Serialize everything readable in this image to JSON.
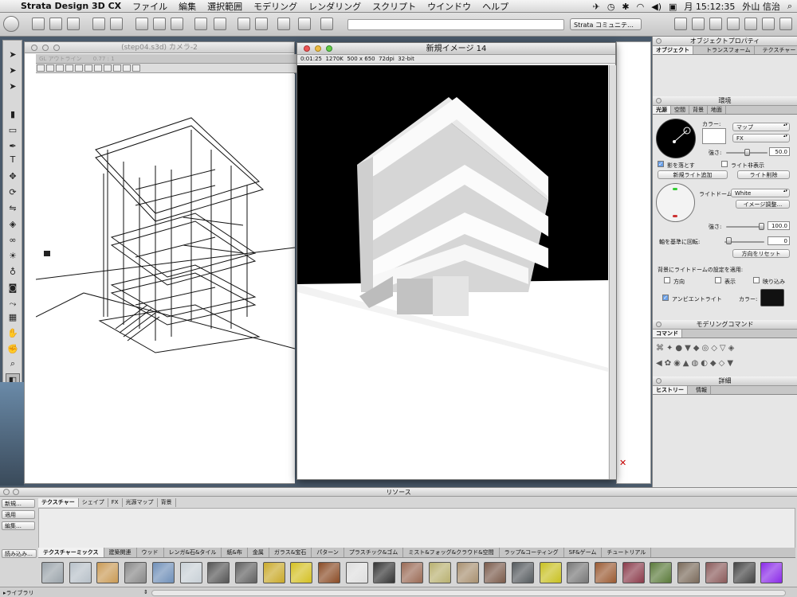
{
  "menubar": {
    "app_name": "Strata Design 3D CX",
    "items": [
      "ファイル",
      "編集",
      "選択範囲",
      "モデリング",
      "レンダリング",
      "スクリプト",
      "ウインドウ",
      "ヘルプ"
    ],
    "clock": "月 15:12:35",
    "user": "外山 信治"
  },
  "toolbar": {
    "community_select": "Strata コミュニテ…"
  },
  "camera_window": {
    "title": "(step04.s3d) カメラ-2",
    "mode": "GL アウトライン",
    "zoom": "0.77 : 1"
  },
  "render_window": {
    "title": "新規イメージ 14",
    "time": "0:01:25",
    "size": "1270K",
    "dims": "500 x 650",
    "dpi": "72dpi",
    "depth": "32-bit"
  },
  "object_props": {
    "title": "オブジェクトプロパティ",
    "tabs": [
      "オブジェクト",
      "トランスフォーム",
      "テクスチャー"
    ]
  },
  "environment": {
    "title": "環境",
    "tabs": [
      "光源",
      "空間",
      "背景",
      "地面"
    ],
    "color_label": "カラー:",
    "map_select": "マップ",
    "fx_select": "FX",
    "strength_label": "強さ:",
    "strength_value": "50.0",
    "cast_shadow": "影を落とす",
    "hide_light": "ライト非表示",
    "add_light": "新規ライト追加",
    "delete_light": "ライト削除",
    "dome_label": "ライトドーム:",
    "dome_select": "White",
    "image_adjust": "イメージ調整…",
    "dome_strength_label": "強さ:",
    "dome_strength_value": "100.0",
    "rotate_label": "軸を基準に回転:",
    "rotate_value": "0",
    "reset_direction": "方向をリセット",
    "apply_label": "背景にライトドームの設定を適用:",
    "apply_direction": "方向",
    "apply_show": "表示",
    "apply_reflect": "映り込み",
    "ambient_label": "アンビエントライト",
    "ambient_color_label": "カラー:"
  },
  "modeling": {
    "title": "モデリングコマンド",
    "tab": "コマンド"
  },
  "detail": {
    "title": "詳細",
    "tabs": [
      "ヒストリー",
      "情報"
    ]
  },
  "resources": {
    "title": "リソース",
    "side_buttons": [
      "新規…",
      "適用",
      "編集…"
    ],
    "tabs": [
      "テクスチャー",
      "シェイプ",
      "FX",
      "光源マップ",
      "背景"
    ],
    "load_button": "読み込み…",
    "library_select": "ライブラリ",
    "library_tabs": [
      "テクスチャーミックス",
      "建築関連",
      "ウッド",
      "レンガ&石&タイル",
      "紙&布",
      "金属",
      "ガラス&宝石",
      "パターン",
      "プラスチック&ゴム",
      "ミスト&フォッグ&クラウド&空間",
      "ラップ&コーティング",
      "SF&ゲーム",
      "チュートリアル"
    ],
    "swatch_colors": [
      "#9aa3aa",
      "#b7c0c8",
      "#c99a55",
      "#888888",
      "#6f8fb8",
      "#c8d0d6",
      "#555555",
      "#606060",
      "#c9a92a",
      "#d4c022",
      "#8a4b25",
      "#dedede",
      "#333333",
      "#9a6a55",
      "#b8b070",
      "#a89070",
      "#7a5a4a",
      "#555a5e",
      "#c8c020",
      "#777777",
      "#9a5a32",
      "#8a3a4a",
      "#5a7a3a",
      "#7a6a5a",
      "#8a5a5a",
      "#444444",
      "#8a2ae8"
    ]
  }
}
